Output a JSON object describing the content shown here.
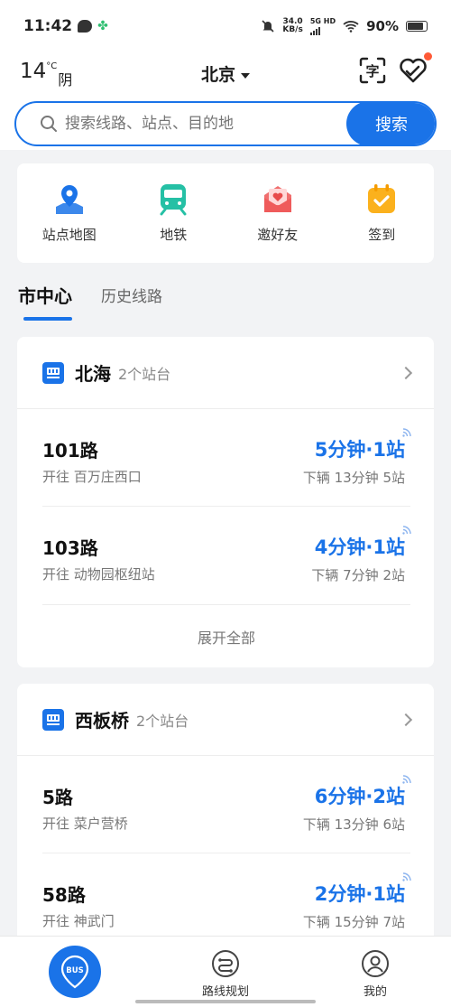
{
  "status_bar": {
    "time": "11:42",
    "speed_value": "34.0",
    "speed_unit": "KB/s",
    "network": "5G HD",
    "battery": "90%"
  },
  "header": {
    "temperature": "14",
    "temp_unit": "°C",
    "condition": "阴",
    "city": "北京"
  },
  "search": {
    "placeholder": "搜索线路、站点、目的地",
    "button_label": "搜索"
  },
  "shortcuts": [
    {
      "label": "站点地图",
      "icon": "map-pin-icon"
    },
    {
      "label": "地铁",
      "icon": "subway-icon"
    },
    {
      "label": "邀好友",
      "icon": "invite-friend-icon"
    },
    {
      "label": "签到",
      "icon": "checkin-calendar-icon"
    }
  ],
  "tabs": {
    "active": "市中心",
    "inactive": "历史线路"
  },
  "stations": [
    {
      "name": "北海",
      "platform_count": "2个站台",
      "routes": [
        {
          "name": "101路",
          "direction": "开往 百万庄西口",
          "eta": "5分钟·1站",
          "next": "下辆  13分钟 5站"
        },
        {
          "name": "103路",
          "direction": "开往 动物园枢纽站",
          "eta": "4分钟·1站",
          "next": "下辆  7分钟 2站"
        }
      ],
      "expand_label": "展开全部"
    },
    {
      "name": "西板桥",
      "platform_count": "2个站台",
      "routes": [
        {
          "name": "5路",
          "direction": "开往 菜户营桥",
          "eta": "6分钟·2站",
          "next": "下辆  13分钟 6站"
        },
        {
          "name": "58路",
          "direction": "开往 神武门",
          "eta": "2分钟·1站",
          "next": "下辆  15分钟 7站"
        }
      ]
    }
  ],
  "bottom_nav": {
    "bus_label": "BUS",
    "route_plan": "路线规划",
    "mine": "我的"
  },
  "colors": {
    "accent": "#1a73e8",
    "badge": "#ff5a37"
  }
}
